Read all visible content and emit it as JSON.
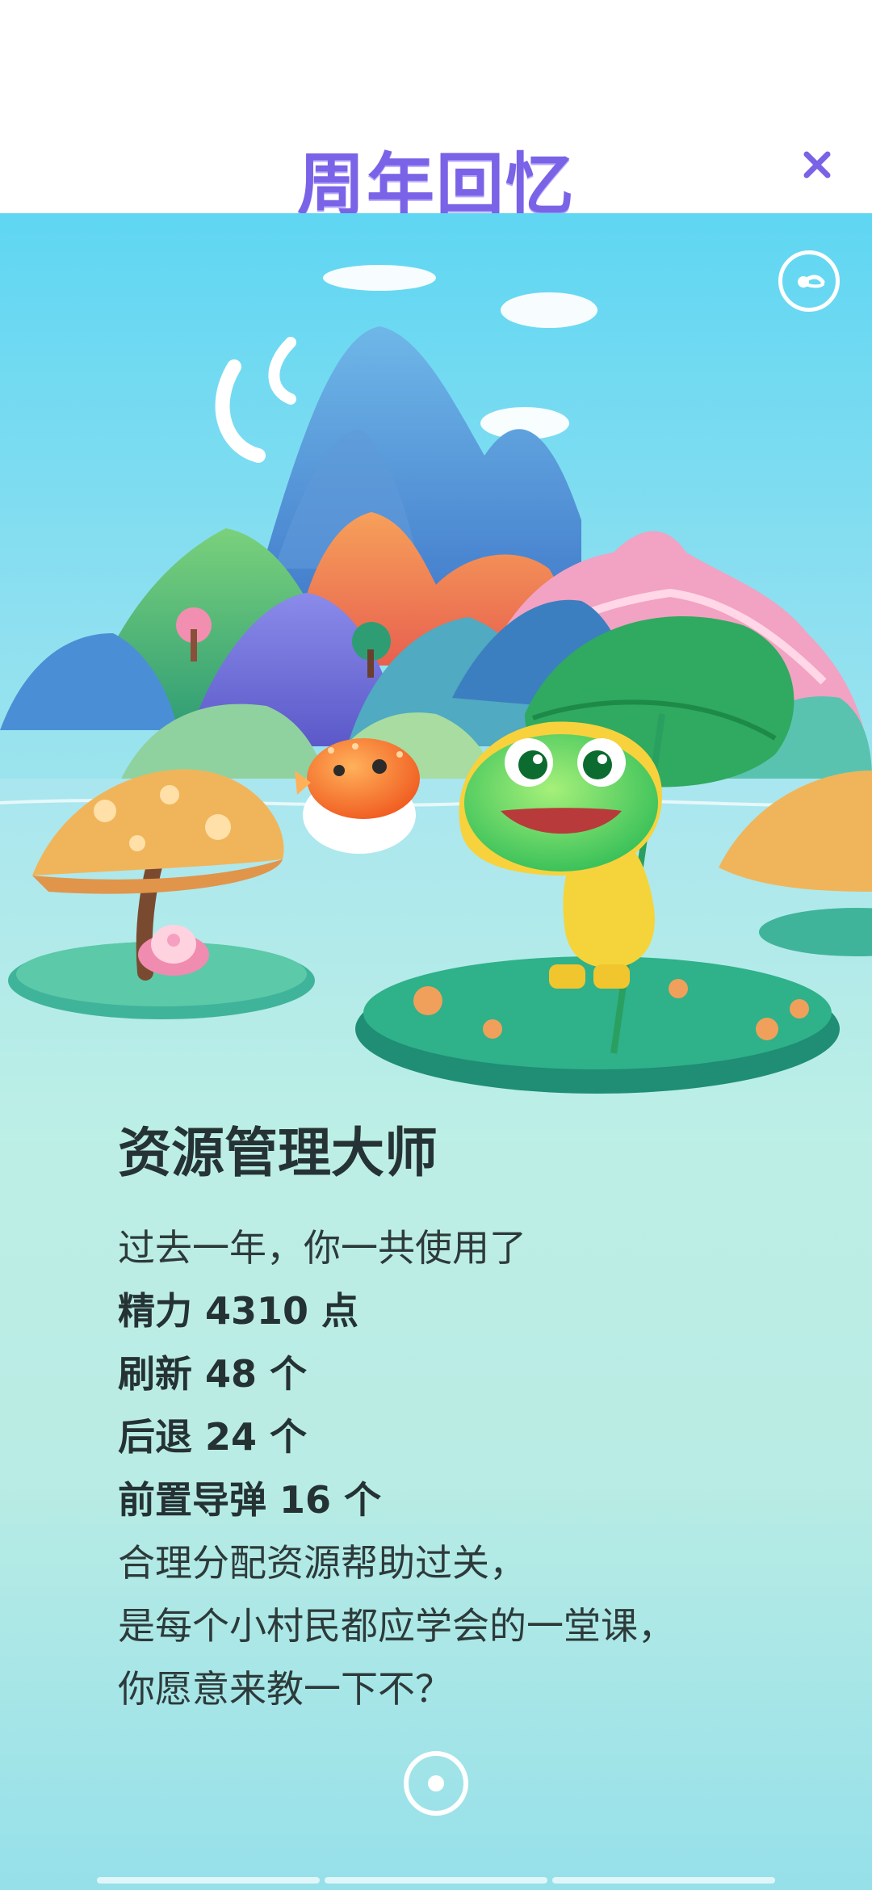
{
  "header": {
    "title": "周年回忆"
  },
  "icons": {
    "close": "close-icon",
    "share": "share-icon",
    "indicator": "record-icon"
  },
  "colors": {
    "title": "#7a63e6",
    "close": "#7a63e6",
    "text": "#2d3a3a"
  },
  "card": {
    "headline": "资源管理大师",
    "intro": "过去一年，你一共使用了",
    "stats": [
      "精力 4310 点",
      "刷新 48 个",
      "后退 24 个",
      "前置导弹 16 个"
    ],
    "outro": [
      "合理分配资源帮助过关，",
      "是每个小村民都应学会的一堂课，",
      "你愿意来教一下不？"
    ]
  }
}
